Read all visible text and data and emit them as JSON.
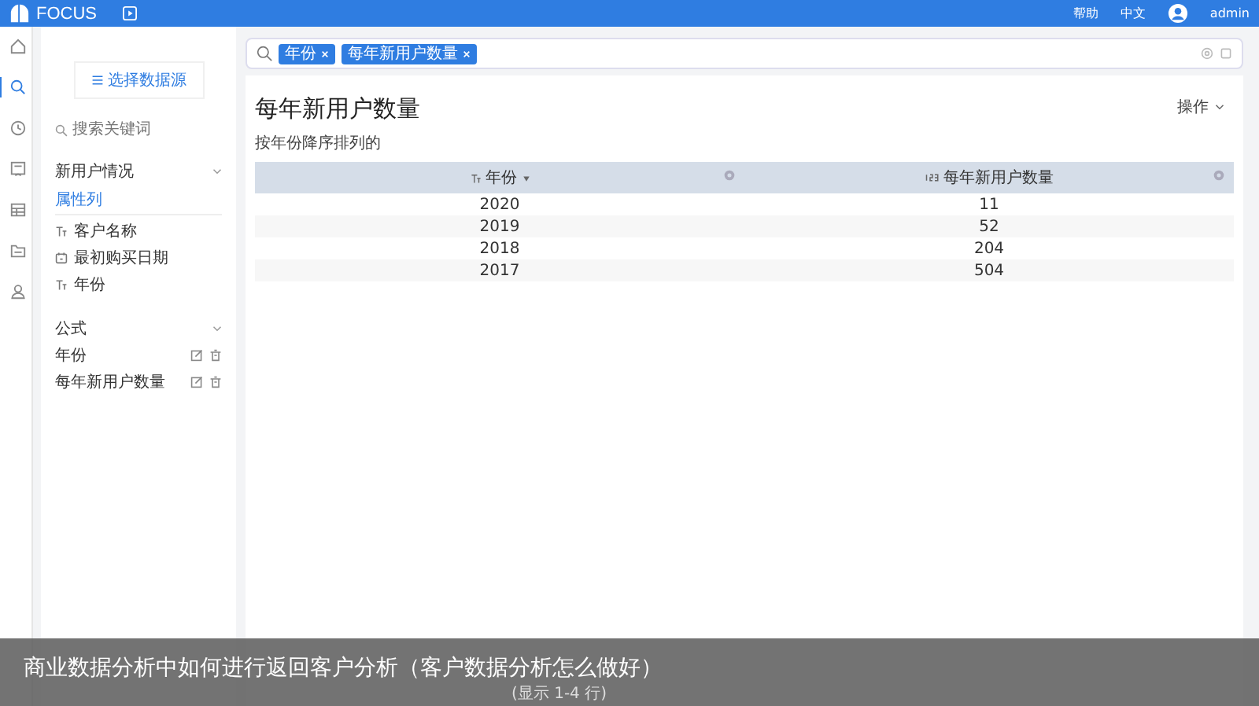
{
  "topbar": {
    "logo": "FOCUS",
    "links": [
      "帮助",
      "中文"
    ],
    "user": "admin"
  },
  "rail": [
    {
      "selected": false
    },
    {
      "selected": true
    },
    {
      "selected": false
    },
    {
      "selected": false
    },
    {
      "selected": false
    },
    {
      "selected": false
    },
    {
      "selected": false
    }
  ],
  "sidebar": {
    "source_button": "选择数据源",
    "search": {
      "placeholder": "搜索关键词"
    },
    "groups": [
      {
        "title": "新用户情况",
        "expanded": true,
        "subtitle": "属性列",
        "items": [
          {
            "label": "客户名称",
            "kind": "text"
          },
          {
            "label": "最初购买日期",
            "kind": "date"
          },
          {
            "label": "年份",
            "kind": "text"
          }
        ]
      },
      {
        "title": "公式",
        "expanded": true,
        "items": [
          {
            "label": "年份",
            "kind": "formula"
          },
          {
            "label": "每年新用户数量",
            "kind": "formula"
          }
        ]
      }
    ]
  },
  "query": {
    "tokens": [
      "年份",
      "每年新用户数量"
    ]
  },
  "result": {
    "title": "每年新用户数量",
    "actions": "操作",
    "description": "按年份降序排列的",
    "table": {
      "columns": [
        {
          "label": "年份",
          "kind": "text",
          "sorted": true
        },
        {
          "label": "每年新用户数量",
          "kind": "number",
          "sorted": false
        }
      ],
      "rows": [
        [
          "2020",
          "11"
        ],
        [
          "2019",
          "52"
        ],
        [
          "2018",
          "204"
        ],
        [
          "2017",
          "504"
        ]
      ]
    },
    "footer": "(显示 1-4 行)"
  },
  "caption": "商业数据分析中如何进行返回客户分析（客户数据分析怎么做好）"
}
